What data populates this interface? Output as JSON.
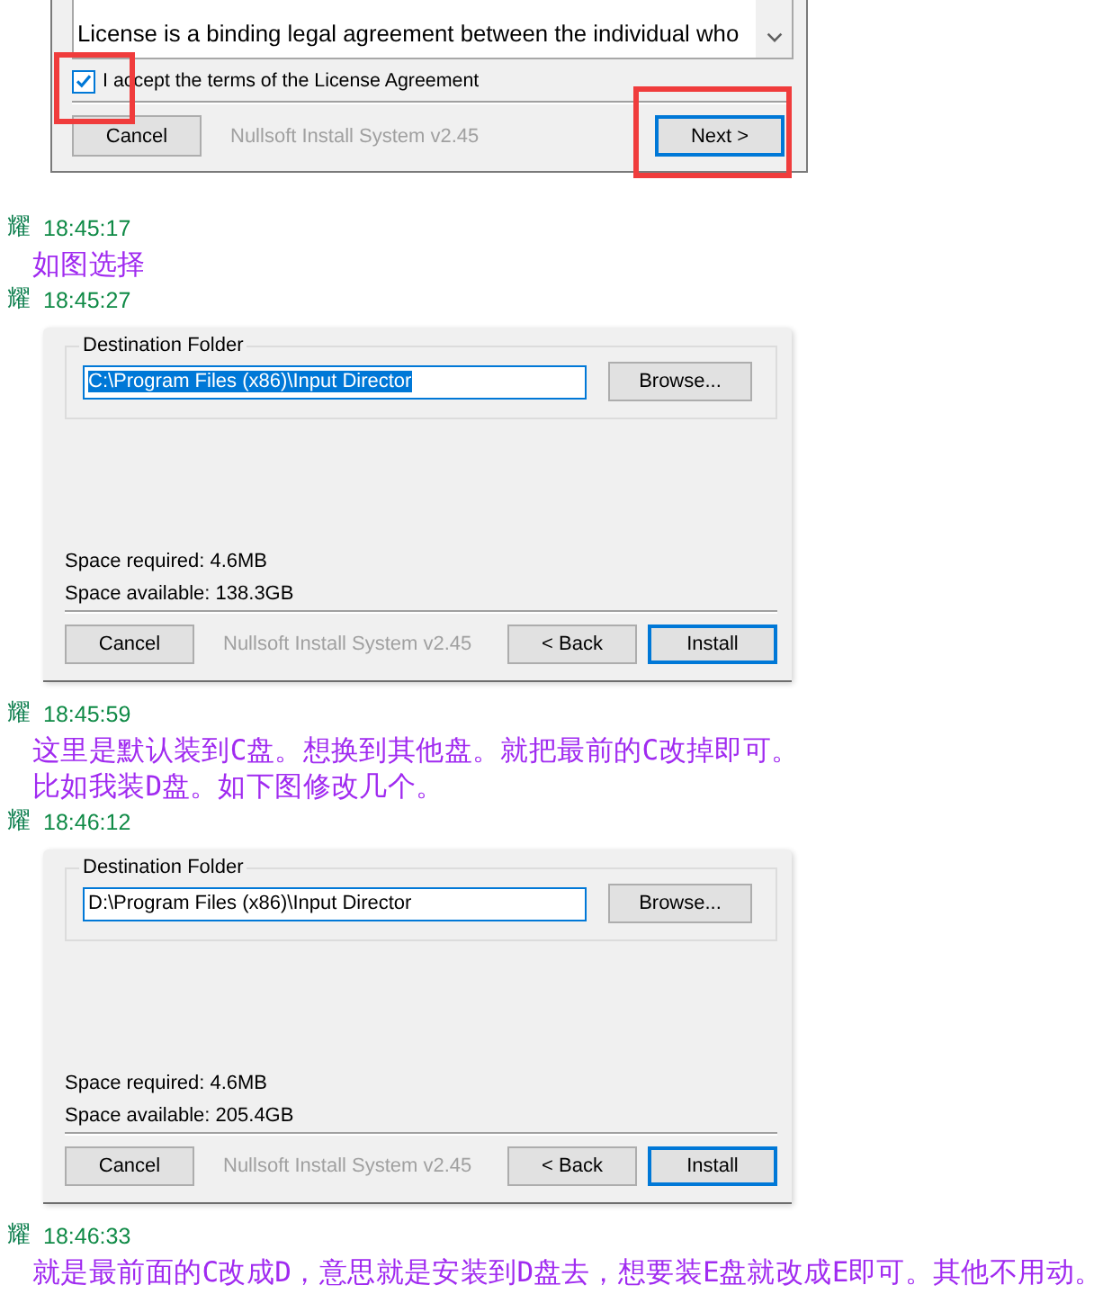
{
  "messages": [
    {
      "body": [
        {
          "kind": "license_dialog",
          "license_text": "License is a binding legal agreement between the individual who",
          "accept": {
            "label": "I accept the terms of the License Agreement",
            "checked": true,
            "highlighted": true
          },
          "cancel_button": {
            "label": "Cancel",
            "default": false
          },
          "brand": "Nullsoft Install System v2.45",
          "nav_buttons": [
            {
              "label": "Next >",
              "default": true,
              "highlighted": true
            }
          ]
        }
      ]
    },
    {
      "sender": "耀",
      "time": "18:45:17",
      "body": [
        {
          "kind": "text",
          "lines": [
            "如图选择"
          ]
        }
      ]
    },
    {
      "sender": "耀",
      "time": "18:45:27",
      "body": [
        {
          "kind": "folder_dialog",
          "group_title": "Destination Folder",
          "path": {
            "value": "C:\\Program Files (x86)\\Input Director",
            "selected": true
          },
          "browse_button": "Browse...",
          "space_required": "Space required: 4.6MB",
          "space_available": "Space available: 138.3GB",
          "cancel_button": {
            "label": "Cancel",
            "default": false
          },
          "brand": "Nullsoft Install System v2.45",
          "nav_buttons": [
            {
              "label": "< Back",
              "default": false
            },
            {
              "label": "Install",
              "default": true
            }
          ]
        }
      ]
    },
    {
      "sender": "耀",
      "time": "18:45:59",
      "body": [
        {
          "kind": "text",
          "lines": [
            "这里是默认装到C盘。想换到其他盘。就把最前的C改掉即可。",
            "比如我装D盘。如下图修改几个。"
          ]
        }
      ]
    },
    {
      "sender": "耀",
      "time": "18:46:12",
      "body": [
        {
          "kind": "folder_dialog",
          "group_title": "Destination Folder",
          "path": {
            "value": "D:\\Program Files (x86)\\Input Director",
            "selected": false
          },
          "browse_button": "Browse...",
          "space_required": "Space required: 4.6MB",
          "space_available": "Space available: 205.4GB",
          "cancel_button": {
            "label": "Cancel",
            "default": false
          },
          "brand": "Nullsoft Install System v2.45",
          "nav_buttons": [
            {
              "label": "< Back",
              "default": false
            },
            {
              "label": "Install",
              "default": true
            }
          ]
        }
      ]
    },
    {
      "sender": "耀",
      "time": "18:46:33",
      "body": [
        {
          "kind": "text",
          "lines": [
            "就是最前面的C改成D，意思就是安装到D盘去，想要装E盘就改成E即可。其他不用动。"
          ]
        }
      ]
    }
  ]
}
